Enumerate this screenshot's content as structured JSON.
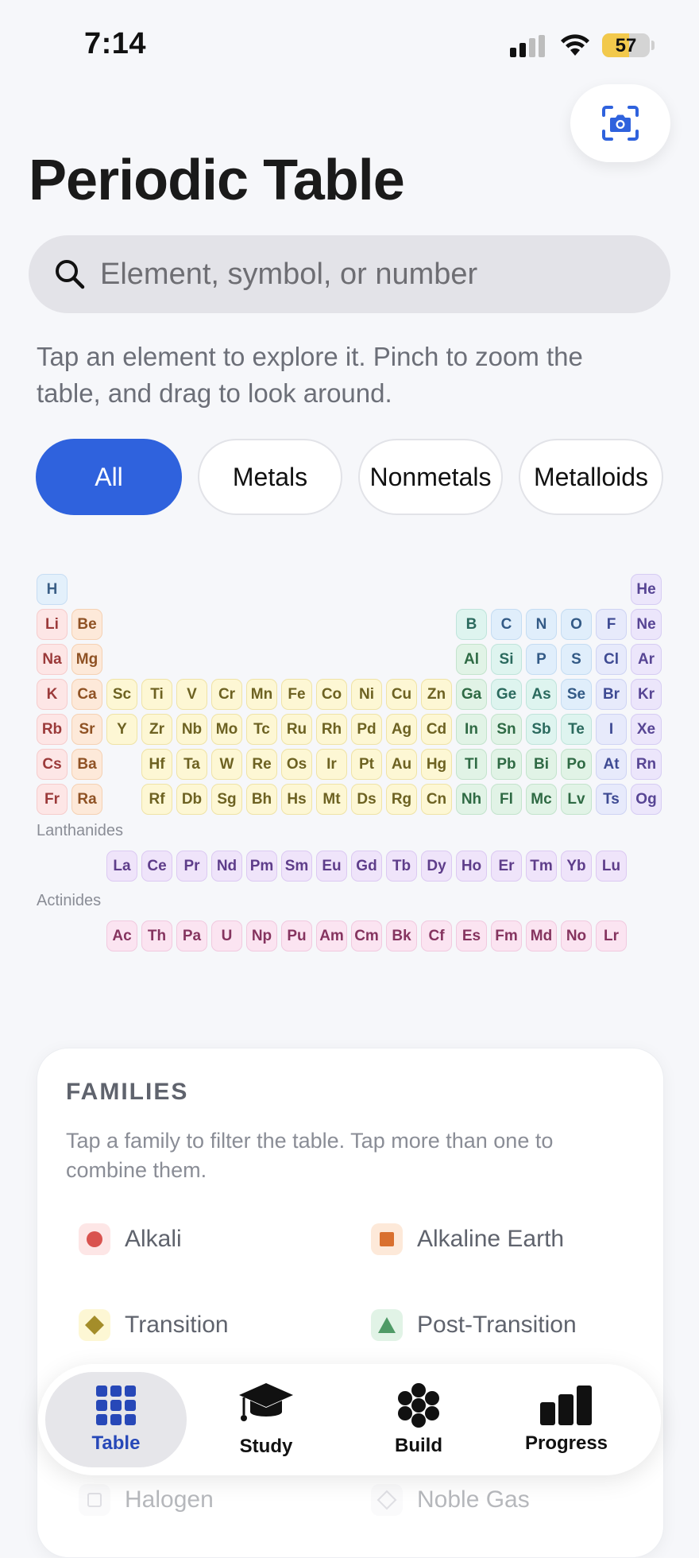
{
  "status_bar": {
    "time": "7:14",
    "battery": "57",
    "battery_level": 0.57
  },
  "header": {
    "title": "Periodic Table"
  },
  "search": {
    "placeholder": "Element, symbol, or number"
  },
  "intro": "Tap an element to explore it. Pinch to zoom the table, and drag to look around.",
  "filters": [
    {
      "label": "All",
      "active": true
    },
    {
      "label": "Metals",
      "active": false
    },
    {
      "label": "Nonmetals",
      "active": false
    },
    {
      "label": "Metalloids",
      "active": false
    }
  ],
  "category_colors": {
    "hydrogen": {
      "bg": "#e3f0fb",
      "border": "#c7ddf3",
      "text": "#3b5f86"
    },
    "alkali": {
      "bg": "#fde6e6",
      "border": "#f6cccc",
      "text": "#9b3a3a"
    },
    "alkaline": {
      "bg": "#fde9d9",
      "border": "#f5d1b3",
      "text": "#8f5224"
    },
    "transition": {
      "bg": "#fdf7d4",
      "border": "#efe3a6",
      "text": "#6d6222"
    },
    "post": {
      "bg": "#e1f3e6",
      "border": "#c3e3cc",
      "text": "#2f6a44"
    },
    "metalloid": {
      "bg": "#def4ef",
      "border": "#bfe4db",
      "text": "#2b6a5e"
    },
    "nonmetal": {
      "bg": "#e0eefb",
      "border": "#c4dcf2",
      "text": "#335a86"
    },
    "halogen": {
      "bg": "#e7eafb",
      "border": "#ced3f3",
      "text": "#3e4a93"
    },
    "noble": {
      "bg": "#ece6fb",
      "border": "#d6ccf3",
      "text": "#574594"
    },
    "lanthanide": {
      "bg": "#efe4fa",
      "border": "#dcc9f2",
      "text": "#5e3d8a"
    },
    "actinide": {
      "bg": "#fbe4f1",
      "border": "#f1c9df",
      "text": "#85345f"
    }
  },
  "table_rows": [
    [
      [
        "H",
        1,
        "hydrogen"
      ],
      [
        "He",
        18,
        "noble"
      ]
    ],
    [
      [
        "Li",
        1,
        "alkali"
      ],
      [
        "Be",
        2,
        "alkaline"
      ],
      [
        "B",
        13,
        "metalloid"
      ],
      [
        "C",
        14,
        "nonmetal"
      ],
      [
        "N",
        15,
        "nonmetal"
      ],
      [
        "O",
        16,
        "nonmetal"
      ],
      [
        "F",
        17,
        "halogen"
      ],
      [
        "Ne",
        18,
        "noble"
      ]
    ],
    [
      [
        "Na",
        1,
        "alkali"
      ],
      [
        "Mg",
        2,
        "alkaline"
      ],
      [
        "Al",
        13,
        "post"
      ],
      [
        "Si",
        14,
        "metalloid"
      ],
      [
        "P",
        15,
        "nonmetal"
      ],
      [
        "S",
        16,
        "nonmetal"
      ],
      [
        "Cl",
        17,
        "halogen"
      ],
      [
        "Ar",
        18,
        "noble"
      ]
    ],
    [
      [
        "K",
        1,
        "alkali"
      ],
      [
        "Ca",
        2,
        "alkaline"
      ],
      [
        "Sc",
        3,
        "transition"
      ],
      [
        "Ti",
        4,
        "transition"
      ],
      [
        "V",
        5,
        "transition"
      ],
      [
        "Cr",
        6,
        "transition"
      ],
      [
        "Mn",
        7,
        "transition"
      ],
      [
        "Fe",
        8,
        "transition"
      ],
      [
        "Co",
        9,
        "transition"
      ],
      [
        "Ni",
        10,
        "transition"
      ],
      [
        "Cu",
        11,
        "transition"
      ],
      [
        "Zn",
        12,
        "transition"
      ],
      [
        "Ga",
        13,
        "post"
      ],
      [
        "Ge",
        14,
        "metalloid"
      ],
      [
        "As",
        15,
        "metalloid"
      ],
      [
        "Se",
        16,
        "nonmetal"
      ],
      [
        "Br",
        17,
        "halogen"
      ],
      [
        "Kr",
        18,
        "noble"
      ]
    ],
    [
      [
        "Rb",
        1,
        "alkali"
      ],
      [
        "Sr",
        2,
        "alkaline"
      ],
      [
        "Y",
        3,
        "transition"
      ],
      [
        "Zr",
        4,
        "transition"
      ],
      [
        "Nb",
        5,
        "transition"
      ],
      [
        "Mo",
        6,
        "transition"
      ],
      [
        "Tc",
        7,
        "transition"
      ],
      [
        "Ru",
        8,
        "transition"
      ],
      [
        "Rh",
        9,
        "transition"
      ],
      [
        "Pd",
        10,
        "transition"
      ],
      [
        "Ag",
        11,
        "transition"
      ],
      [
        "Cd",
        12,
        "transition"
      ],
      [
        "In",
        13,
        "post"
      ],
      [
        "Sn",
        14,
        "post"
      ],
      [
        "Sb",
        15,
        "metalloid"
      ],
      [
        "Te",
        16,
        "metalloid"
      ],
      [
        "I",
        17,
        "halogen"
      ],
      [
        "Xe",
        18,
        "noble"
      ]
    ],
    [
      [
        "Cs",
        1,
        "alkali"
      ],
      [
        "Ba",
        2,
        "alkaline"
      ],
      [
        "Hf",
        4,
        "transition"
      ],
      [
        "Ta",
        5,
        "transition"
      ],
      [
        "W",
        6,
        "transition"
      ],
      [
        "Re",
        7,
        "transition"
      ],
      [
        "Os",
        8,
        "transition"
      ],
      [
        "Ir",
        9,
        "transition"
      ],
      [
        "Pt",
        10,
        "transition"
      ],
      [
        "Au",
        11,
        "transition"
      ],
      [
        "Hg",
        12,
        "transition"
      ],
      [
        "Tl",
        13,
        "post"
      ],
      [
        "Pb",
        14,
        "post"
      ],
      [
        "Bi",
        15,
        "post"
      ],
      [
        "Po",
        16,
        "post"
      ],
      [
        "At",
        17,
        "halogen"
      ],
      [
        "Rn",
        18,
        "noble"
      ]
    ],
    [
      [
        "Fr",
        1,
        "alkali"
      ],
      [
        "Ra",
        2,
        "alkaline"
      ],
      [
        "Rf",
        4,
        "transition"
      ],
      [
        "Db",
        5,
        "transition"
      ],
      [
        "Sg",
        6,
        "transition"
      ],
      [
        "Bh",
        7,
        "transition"
      ],
      [
        "Hs",
        8,
        "transition"
      ],
      [
        "Mt",
        9,
        "transition"
      ],
      [
        "Ds",
        10,
        "transition"
      ],
      [
        "Rg",
        11,
        "transition"
      ],
      [
        "Cn",
        12,
        "transition"
      ],
      [
        "Nh",
        13,
        "post"
      ],
      [
        "Fl",
        14,
        "post"
      ],
      [
        "Mc",
        15,
        "post"
      ],
      [
        "Lv",
        16,
        "post"
      ],
      [
        "Ts",
        17,
        "halogen"
      ],
      [
        "Og",
        18,
        "noble"
      ]
    ]
  ],
  "lanthanides": {
    "label": "Lanthanides",
    "elements": [
      "La",
      "Ce",
      "Pr",
      "Nd",
      "Pm",
      "Sm",
      "Eu",
      "Gd",
      "Tb",
      "Dy",
      "Ho",
      "Er",
      "Tm",
      "Yb",
      "Lu"
    ]
  },
  "actinides": {
    "label": "Actinides",
    "elements": [
      "Ac",
      "Th",
      "Pa",
      "U",
      "Np",
      "Pu",
      "Am",
      "Cm",
      "Bk",
      "Cf",
      "Es",
      "Fm",
      "Md",
      "No",
      "Lr"
    ]
  },
  "families": {
    "title": "FAMILIES",
    "description": "Tap a family to filter the table. Tap more than one to combine them.",
    "items": [
      {
        "label": "Alkali",
        "icon": "circle-icon",
        "color": "#d9534f",
        "bg": "#fde6e6"
      },
      {
        "label": "Alkaline Earth",
        "icon": "square-icon",
        "color": "#d9702f",
        "bg": "#fde9d9"
      },
      {
        "label": "Transition",
        "icon": "diamond-icon",
        "color": "#a48d2a",
        "bg": "#fdf7d4"
      },
      {
        "label": "Post-Transition",
        "icon": "triangle-icon",
        "color": "#4f9a66",
        "bg": "#e1f3e6"
      },
      {
        "label": "Halogen",
        "icon": "square-outline-icon",
        "color": "#c9c9d2",
        "bg": "#f4f4f7"
      },
      {
        "label": "Noble Gas",
        "icon": "diamond-outline-icon",
        "color": "#c9c9d2",
        "bg": "#f4f4f7"
      }
    ]
  },
  "tabbar": {
    "tabs": [
      {
        "label": "Table",
        "icon": "grid-icon",
        "active": true
      },
      {
        "label": "Study",
        "icon": "graduation-cap-icon",
        "active": false
      },
      {
        "label": "Build",
        "icon": "atom-cluster-icon",
        "active": false
      },
      {
        "label": "Progress",
        "icon": "bar-chart-icon",
        "active": false
      }
    ]
  },
  "accent_color": "#2f62dd"
}
